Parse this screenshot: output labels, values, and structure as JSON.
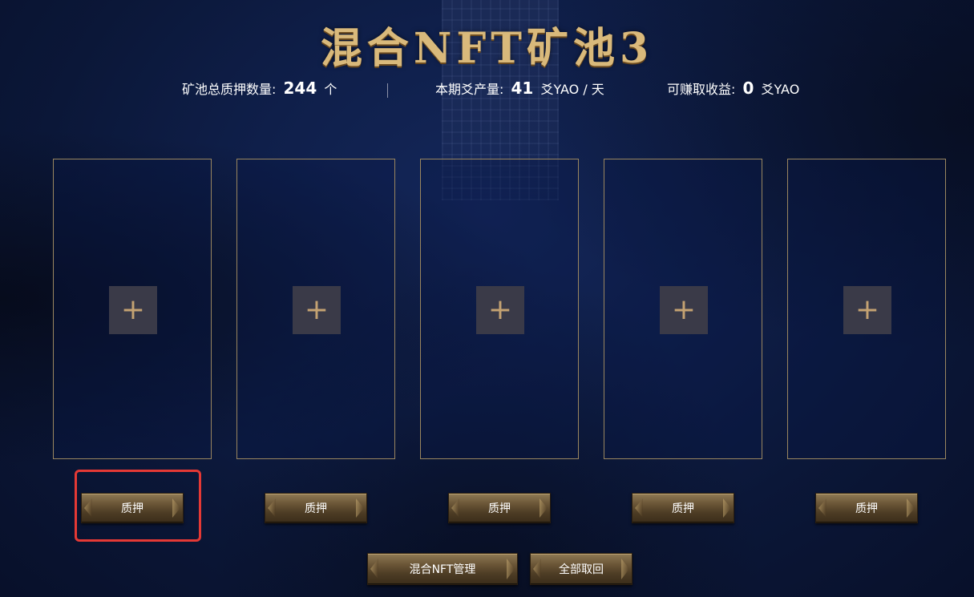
{
  "title": "混合NFT矿池3",
  "stats": {
    "total_staked_label": "矿池总质押数量:",
    "total_staked_value": "244",
    "total_staked_unit": "个",
    "period_output_label": "本期爻产量:",
    "period_output_value": "41",
    "period_output_unit": "爻YAO / 天",
    "earnable_label": "可赚取收益:",
    "earnable_value": "0",
    "earnable_unit": "爻YAO"
  },
  "slots": [
    {
      "add_glyph": "+",
      "stake_label": "质押"
    },
    {
      "add_glyph": "+",
      "stake_label": "质押"
    },
    {
      "add_glyph": "+",
      "stake_label": "质押"
    },
    {
      "add_glyph": "+",
      "stake_label": "质押"
    },
    {
      "add_glyph": "+",
      "stake_label": "质押"
    }
  ],
  "actions": {
    "manage_label": "混合NFT管理",
    "withdraw_all_label": "全部取回"
  },
  "colors": {
    "accent_gold": "#d9b97b",
    "highlight_red": "#e53935",
    "slot_border": "#9a865f"
  }
}
